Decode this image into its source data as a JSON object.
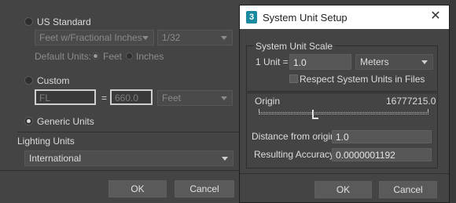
{
  "background_dialog": {
    "us_standard_label": "US Standard",
    "us_standard_selected": false,
    "fraction_select": "Feet w/Fractional Inches",
    "precision_select": "1/32",
    "default_units_label": "Default Units:",
    "feet_label": "Feet",
    "inches_label": "Inches",
    "custom_label": "Custom",
    "custom_name_value": "FL",
    "equals": "=",
    "custom_amount_value": "660.0",
    "custom_unit_select": "Feet",
    "generic_units_label": "Generic Units",
    "generic_units_selected": true,
    "lighting_units_label": "Lighting Units",
    "lighting_units_select": "International",
    "ok_label": "OK",
    "cancel_label": "Cancel"
  },
  "system_unit_dialog": {
    "title": "System Unit Setup",
    "title_icon_glyph": "3",
    "close_glyph": "✕",
    "scale_group_label": "System Unit Scale",
    "unit_label": "1 Unit =",
    "unit_value": "1.0",
    "unit_type": "Meters",
    "respect_label": "Respect System Units in Files",
    "respect_checked": false,
    "origin_label": "Origin",
    "origin_value": "16777215.0",
    "slider_position_fraction": 0.35,
    "distance_label": "Distance from origin:",
    "distance_value": "1.0",
    "accuracy_label": "Resulting Accuracy:",
    "accuracy_value": "0.0000001192",
    "ok_label": "OK",
    "cancel_label": "Cancel"
  },
  "colors": {
    "panel": "#444444",
    "titlebar": "#ffffff",
    "icon_accent": "#1a8aa0"
  }
}
